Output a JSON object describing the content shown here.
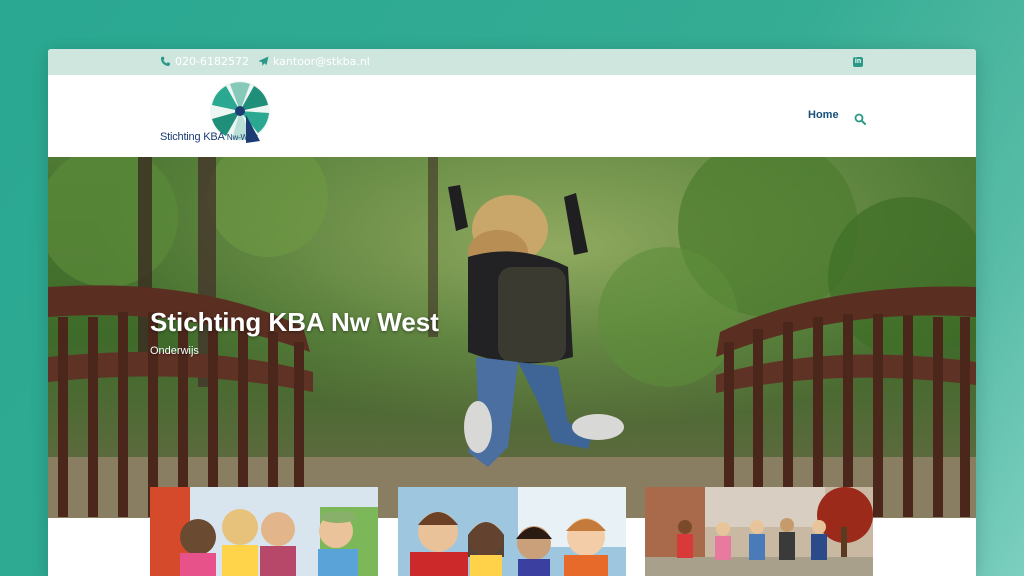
{
  "topbar": {
    "phone": "020-6182572",
    "phone_icon": "phone-icon",
    "email": "kantoor@stkba.nl",
    "email_icon": "paper-plane-icon",
    "social_icon": "linkedin-icon"
  },
  "header": {
    "logo_text_main": "Stichting KBA",
    "logo_text_small": "Nw-West",
    "nav_home": "Home",
    "search_icon": "search-icon"
  },
  "hero": {
    "title": "Stichting KBA Nw West",
    "subtitle": "Onderwijs"
  },
  "colors": {
    "accent": "#2a9a86",
    "nav": "#15507a",
    "topbar_bg": "#cfe6df",
    "logo_blue": "#1c3d74"
  },
  "cards": [
    {
      "image": "children-group-photo"
    },
    {
      "image": "smiling-kids-photo"
    },
    {
      "image": "students-walking-photo"
    }
  ]
}
